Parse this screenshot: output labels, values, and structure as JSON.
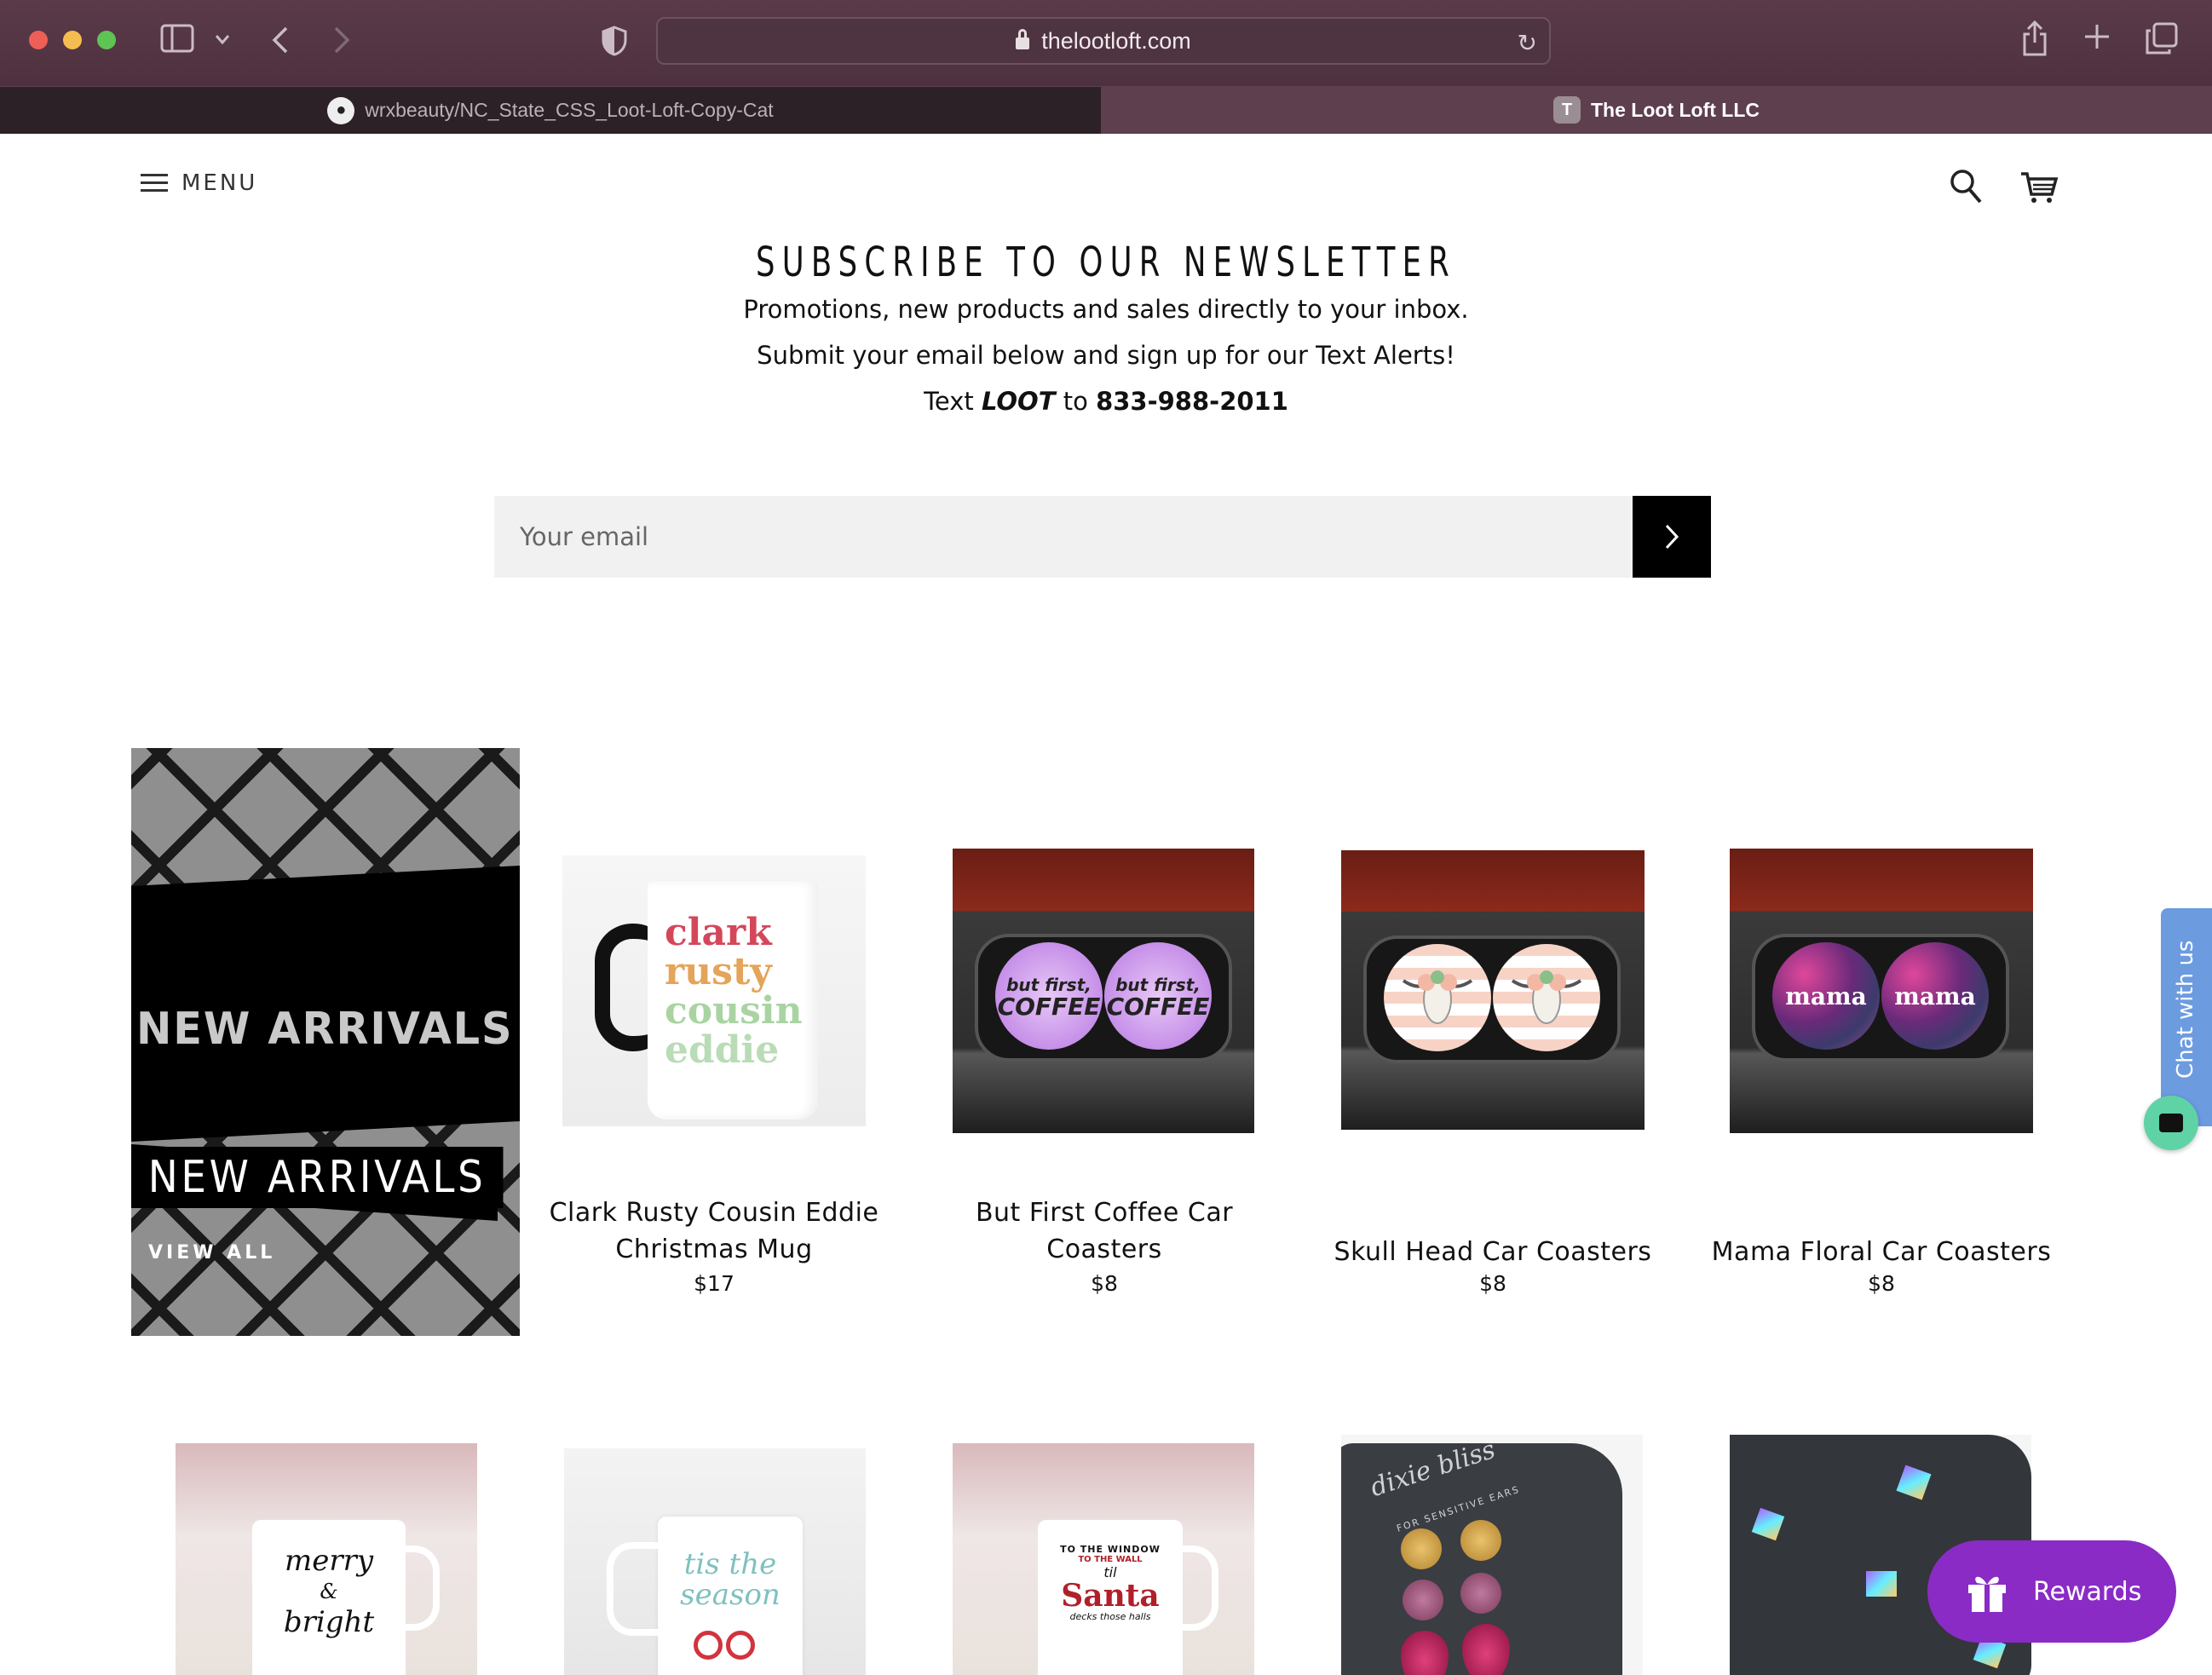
{
  "browser": {
    "url": "thelootloft.com",
    "tabs": [
      {
        "label": "wrxbeauty/NC_State_CSS_Loot-Loft-Copy-Cat",
        "favicon": "github-icon",
        "active": false
      },
      {
        "label": "The Loot Loft LLC",
        "favicon": "T",
        "active": true
      }
    ]
  },
  "header": {
    "menu_label": "MENU"
  },
  "newsletter": {
    "title": "SUBSCRIBE TO OUR NEWSLETTER",
    "line1": "Promotions, new products and sales directly to your inbox.",
    "line2": "Submit your email below and sign up for our Text Alerts!",
    "line3_prefix": "Text",
    "line3_keyword": "LOOT",
    "line3_mid": "to",
    "line3_phone": "833-988-2011",
    "email_placeholder": "Your email"
  },
  "feature": {
    "background_label": "NEW ARRIVALS",
    "title": "NEW ARRIVALS",
    "link": "VIEW ALL"
  },
  "products": [
    {
      "name": "Clark Rusty Cousin Eddie Christmas Mug",
      "price": "$17",
      "image_text": [
        "clark",
        "rusty",
        "cousin",
        "eddie"
      ]
    },
    {
      "name": "But First Coffee Car Coasters",
      "price": "$8",
      "image_text": [
        "but first,",
        "COFFEE"
      ]
    },
    {
      "name": "Skull Head Car Coasters",
      "price": "$8"
    },
    {
      "name": "Mama Floral Car Coasters",
      "price": "$8",
      "image_text": [
        "mama"
      ]
    }
  ],
  "row2_images": [
    {
      "image_text": [
        "merry",
        "&",
        "bright"
      ]
    },
    {
      "image_text": [
        "tis the",
        "season"
      ]
    },
    {
      "image_text": [
        "TO THE WINDOW",
        "TO THE WALL",
        "til",
        "Santa",
        "decks those halls"
      ]
    },
    {
      "image_text": [
        "dixie bliss",
        "FOR SENSITIVE EARS"
      ]
    },
    {
      "image_text": []
    }
  ],
  "widgets": {
    "chat_label": "Chat with us",
    "rewards_label": "Rewards"
  },
  "colors": {
    "chrome": "#5a3a48",
    "accent_rewards": "#8a2bc5",
    "chat_tab": "#6c9be0",
    "submit_button": "#000000"
  }
}
